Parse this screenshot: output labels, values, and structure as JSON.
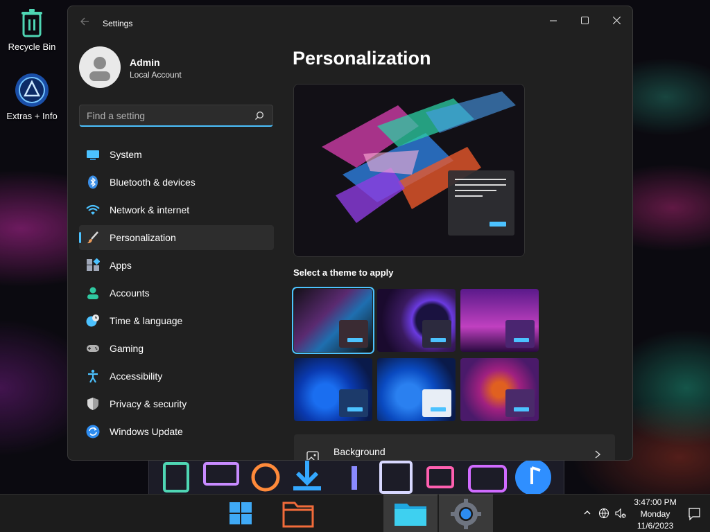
{
  "desktop": {
    "icons": [
      {
        "label": "Recycle Bin",
        "icon": "recycle-bin-icon"
      },
      {
        "label": "Extras + Info",
        "icon": "extras-info-icon"
      }
    ]
  },
  "window": {
    "title": "Settings",
    "controls": [
      "minimize",
      "maximize",
      "close"
    ]
  },
  "profile": {
    "name": "Admin",
    "account_type": "Local Account"
  },
  "search": {
    "placeholder": "Find a setting",
    "value": ""
  },
  "nav": {
    "items": [
      {
        "label": "System",
        "icon": "system-icon",
        "color": "#4cc2ff"
      },
      {
        "label": "Bluetooth & devices",
        "icon": "bluetooth-icon",
        "color": "#3a8ee6"
      },
      {
        "label": "Network & internet",
        "icon": "wifi-icon",
        "color": "#4cc2ff"
      },
      {
        "label": "Personalization",
        "icon": "paintbrush-icon",
        "color": "#e89a5a",
        "selected": true
      },
      {
        "label": "Apps",
        "icon": "apps-icon",
        "color": "#a0a8b8"
      },
      {
        "label": "Accounts",
        "icon": "accounts-icon",
        "color": "#2fc8a0"
      },
      {
        "label": "Time & language",
        "icon": "clock-globe-icon",
        "color": "#4cc2ff"
      },
      {
        "label": "Gaming",
        "icon": "gamepad-icon",
        "color": "#b0b0b0"
      },
      {
        "label": "Accessibility",
        "icon": "accessibility-icon",
        "color": "#4cc2ff"
      },
      {
        "label": "Privacy & security",
        "icon": "shield-icon",
        "color": "#a0a0a0"
      },
      {
        "label": "Windows Update",
        "icon": "update-icon",
        "color": "#2d8cf0"
      }
    ]
  },
  "main": {
    "title": "Personalization",
    "theme_heading": "Select a theme to apply",
    "themes": [
      {
        "name": "theme-1",
        "selected": true
      },
      {
        "name": "theme-2"
      },
      {
        "name": "theme-3"
      },
      {
        "name": "theme-4"
      },
      {
        "name": "theme-5"
      },
      {
        "name": "theme-6"
      }
    ],
    "settings_rows": [
      {
        "label": "Background",
        "icon": "image-icon"
      }
    ]
  },
  "taskbar": {
    "clock": {
      "time": "3:47:00 PM",
      "day": "Monday",
      "date": "11/6/2023"
    },
    "accent": "#4cc2ff"
  }
}
